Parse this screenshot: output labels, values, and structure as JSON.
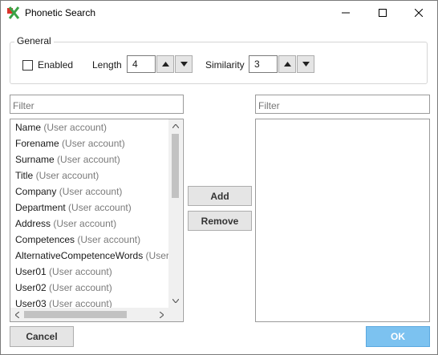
{
  "window": {
    "title": "Phonetic Search"
  },
  "general": {
    "legend": "General",
    "enabled_label": "Enabled",
    "length_label": "Length",
    "length_value": "4",
    "similarity_label": "Similarity",
    "similarity_value": "3"
  },
  "left_filter": {
    "placeholder": "Filter"
  },
  "right_filter": {
    "placeholder": "Filter"
  },
  "available_fields": [
    {
      "name": "Name",
      "source": "(User account)"
    },
    {
      "name": "Forename",
      "source": "(User account)"
    },
    {
      "name": "Surname",
      "source": "(User account)"
    },
    {
      "name": "Title",
      "source": "(User account)"
    },
    {
      "name": "Company",
      "source": "(User account)"
    },
    {
      "name": "Department",
      "source": "(User account)"
    },
    {
      "name": "Address",
      "source": "(User account)"
    },
    {
      "name": "Competences",
      "source": "(User account)"
    },
    {
      "name": "AlternativeCompetenceWords",
      "source": "(User"
    },
    {
      "name": "User01",
      "source": "(User account)"
    },
    {
      "name": "User02",
      "source": "(User account)"
    },
    {
      "name": "User03",
      "source": "(User account)"
    }
  ],
  "actions": {
    "add": "Add",
    "remove": "Remove"
  },
  "footer": {
    "cancel": "Cancel",
    "ok": "OK"
  },
  "colors": {
    "ok_button": "#7cc2f0",
    "app_icon_green": "#3aa346",
    "app_icon_red": "#d9342b"
  }
}
